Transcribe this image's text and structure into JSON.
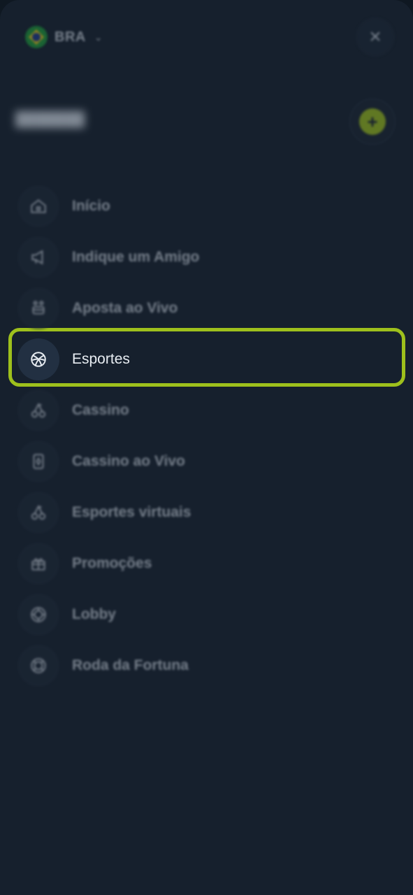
{
  "header": {
    "language_code": "BRA",
    "flag_icon": "brazil-flag-icon",
    "chevron_icon": "chevron-down-icon",
    "close_icon": "close-icon"
  },
  "user": {
    "add_button_icon": "plus-icon",
    "accent_color": "#9ec01c"
  },
  "menu": {
    "items": [
      {
        "label": "Início",
        "icon": "home-icon"
      },
      {
        "label": "Indique um Amigo",
        "icon": "megaphone-icon"
      },
      {
        "label": "Aposta ao Vivo",
        "icon": "live-bet-icon"
      },
      {
        "label": "Esportes",
        "icon": "ball-icon",
        "active": true
      },
      {
        "label": "Cassino",
        "icon": "cherries-icon"
      },
      {
        "label": "Cassino ao Vivo",
        "icon": "card-icon"
      },
      {
        "label": "Esportes virtuais",
        "icon": "cherries-icon"
      },
      {
        "label": "Promoções",
        "icon": "gift-icon"
      },
      {
        "label": "Lobby",
        "icon": "chip-icon"
      },
      {
        "label": "Roda da Fortuna",
        "icon": "wheel-icon"
      }
    ]
  }
}
